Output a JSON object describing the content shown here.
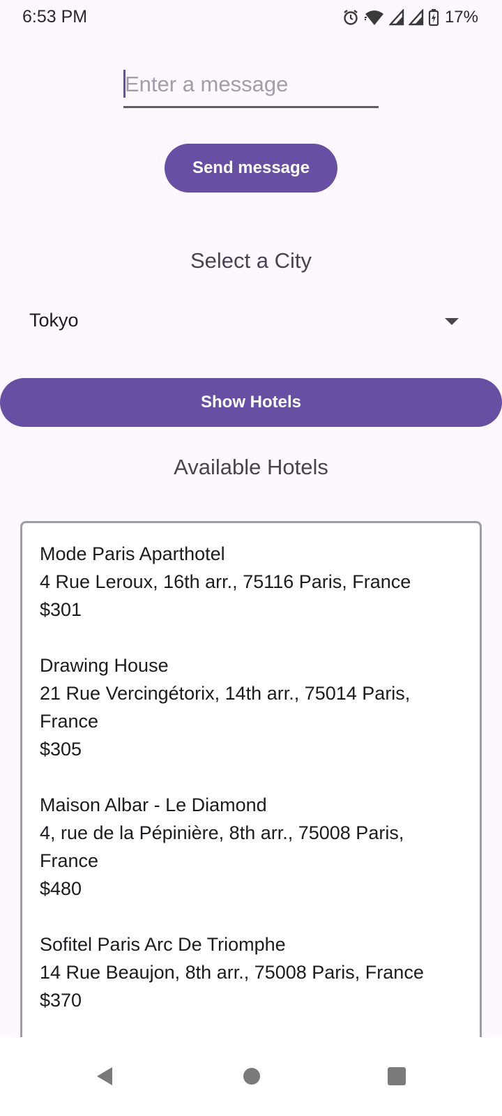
{
  "status_bar": {
    "time": "6:53 PM",
    "battery": "17%",
    "icons": [
      "alarm-icon",
      "wifi-icon",
      "signal-icon",
      "signal-icon",
      "battery-charging-icon"
    ]
  },
  "message": {
    "placeholder": "Enter a message",
    "value": ""
  },
  "send_button": {
    "label": "Send message"
  },
  "city_section": {
    "title": "Select a City",
    "selected": "Tokyo"
  },
  "show_hotels_button": {
    "label": "Show Hotels"
  },
  "hotels_section": {
    "title": "Available Hotels",
    "items": [
      {
        "name": "Mode Paris Aparthotel",
        "address": "4 Rue Leroux, 16th arr., 75116 Paris, France",
        "price": "$301"
      },
      {
        "name": "Drawing House",
        "address": "21 Rue Vercingétorix, 14th arr., 75014 Paris, France",
        "price": "$305"
      },
      {
        "name": "Maison Albar - Le Diamond",
        "address": "4, rue de la Pépinière, 8th arr., 75008 Paris, France",
        "price": "$480"
      },
      {
        "name": "Sofitel Paris Arc De Triomphe",
        "address": "14 Rue Beaujon, 8th arr., 75008 Paris, France",
        "price": "$370"
      }
    ]
  },
  "nav_bar": {
    "icons": [
      "back-icon",
      "home-icon",
      "recents-icon"
    ]
  },
  "colors": {
    "accent": "#6750A4",
    "background": "#FDF7FF",
    "text_secondary": "#49454F"
  }
}
